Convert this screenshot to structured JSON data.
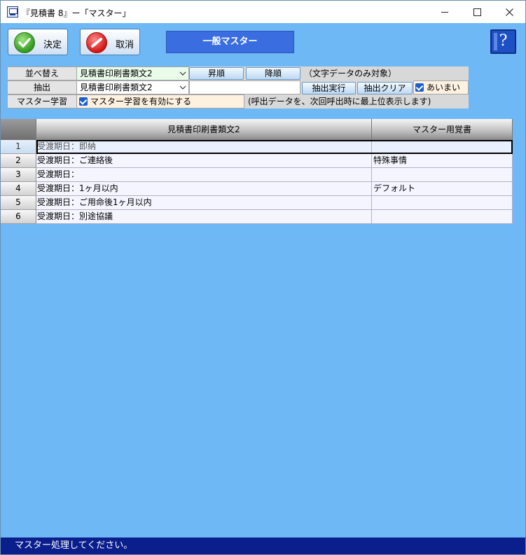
{
  "window": {
    "title": "『見積書 8』ー「マスター」"
  },
  "toolbar": {
    "ok_label": "決定",
    "cancel_label": "取消",
    "mode_label": "一般マスター",
    "help_label": "?"
  },
  "controls": {
    "sort": {
      "label": "並べ替え",
      "field": "見積書印刷書類文2",
      "asc_label": "昇順",
      "desc_label": "降順",
      "note": "（文字データのみ対象）"
    },
    "filter": {
      "label": "抽出",
      "field": "見積書印刷書類文2",
      "value": "",
      "run_label": "抽出実行",
      "clear_label": "抽出クリア",
      "fuzzy_label": "あいまい",
      "fuzzy_checked": true
    },
    "learning": {
      "label": "マスター学習",
      "enable_label": "マスター学習を有効にする",
      "enable_checked": true,
      "note": "(呼出データを、次回呼出時に最上位表示します)"
    }
  },
  "grid": {
    "columns": [
      "見積書印刷書類文2",
      "マスター用覚書"
    ],
    "rows": [
      {
        "num": "1",
        "text": "受渡期日：即納",
        "memo": ""
      },
      {
        "num": "2",
        "text": "受渡期日：ご連絡後",
        "memo": "特殊事情"
      },
      {
        "num": "3",
        "text": "受渡期日：",
        "memo": ""
      },
      {
        "num": "4",
        "text": "受渡期日：1ヶ月以内",
        "memo": "デフォルト"
      },
      {
        "num": "5",
        "text": "受渡期日：ご用命後1ヶ月以内",
        "memo": ""
      },
      {
        "num": "6",
        "text": "受渡期日：別途協議",
        "memo": ""
      }
    ],
    "selected_row": "1"
  },
  "status": {
    "message": "マスター処理してください。"
  },
  "colors": {
    "background": "#6db8f5",
    "mode_label": "#3a6ee0",
    "status_bar": "#0a1e8c"
  },
  "icons": {
    "ok": "check-circle-icon",
    "cancel": "no-entry-icon",
    "help": "help-book-icon"
  }
}
